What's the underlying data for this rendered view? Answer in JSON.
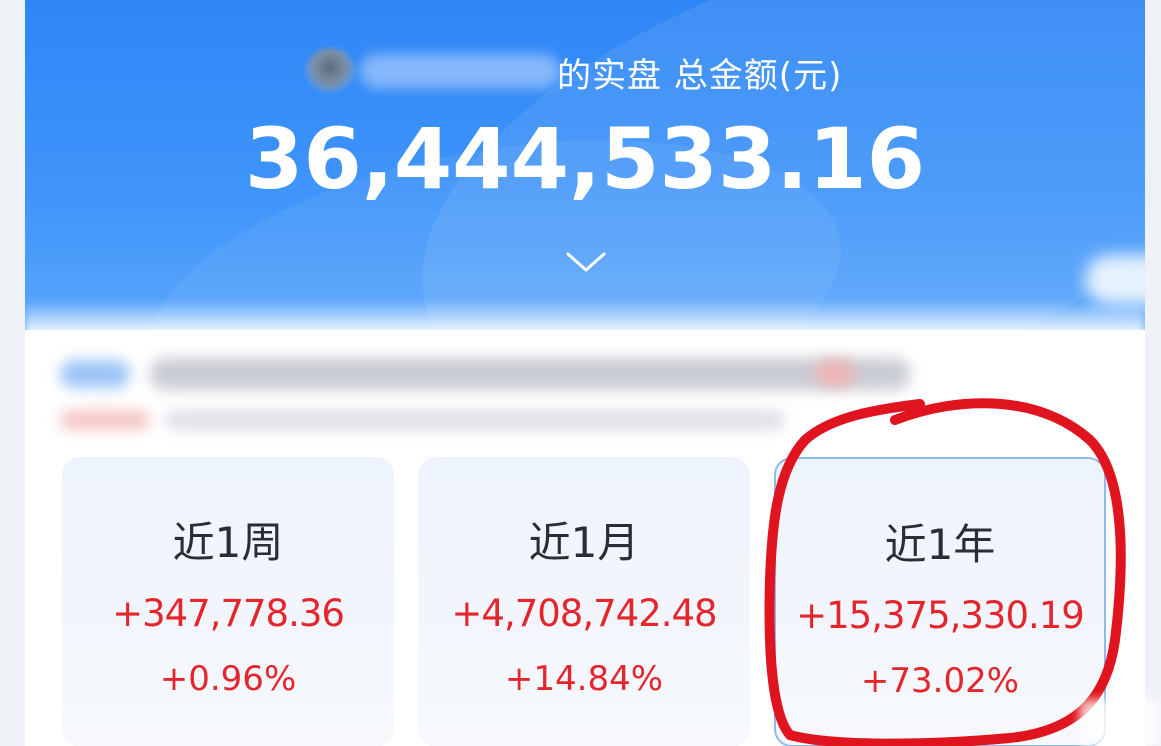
{
  "header": {
    "account_label": "的实盘 总金额(元)",
    "total_amount": "36,444,533.16",
    "expand_icon": "chevron-down-icon"
  },
  "periods": [
    {
      "label": "近1周",
      "amount": "+347,778.36",
      "percent": "+0.96%"
    },
    {
      "label": "近1月",
      "amount": "+4,708,742.48",
      "percent": "+14.84%"
    },
    {
      "label": "近1年",
      "amount": "+15,375,330.19",
      "percent": "+73.02%"
    }
  ],
  "colors": {
    "header_blue": "#2f86f6",
    "gain_red": "#e4262c",
    "annotation_red": "#e0141e",
    "card_bg": "#eef4fd"
  }
}
